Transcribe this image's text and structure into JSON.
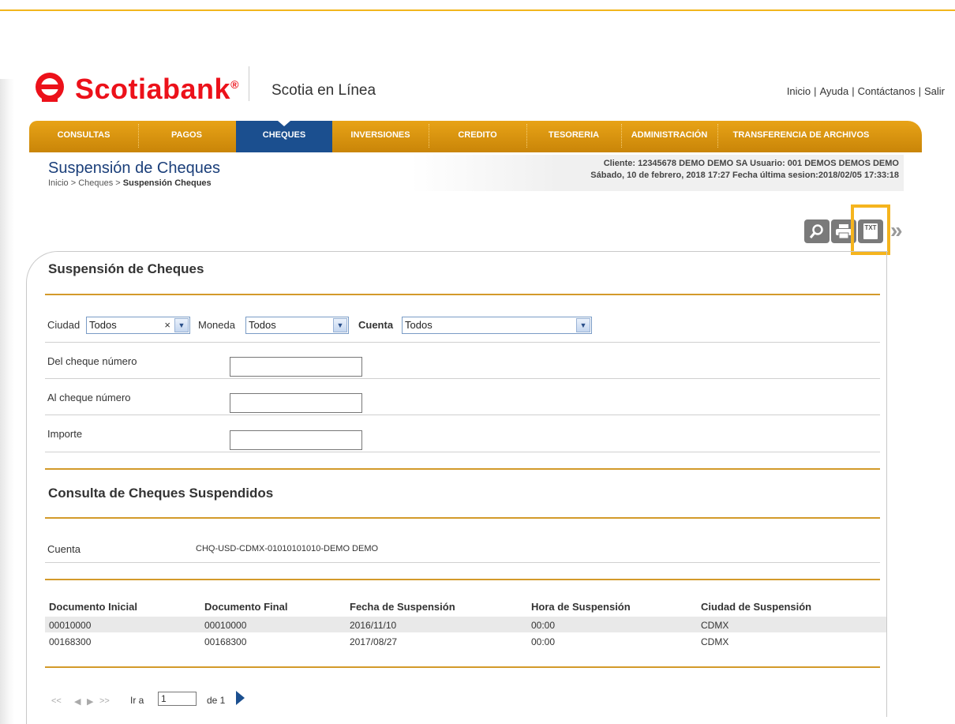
{
  "brand": {
    "name": "Scotiabank",
    "mark": "®",
    "app": "Scotia en Línea",
    "color": "#ec111a"
  },
  "top_links": [
    "Inicio",
    "Ayuda",
    "Contáctanos",
    "Salir"
  ],
  "nav": {
    "items": [
      "CONSULTAS",
      "PAGOS",
      "CHEQUES",
      "INVERSIONES",
      "CREDITO",
      "TESORERIA",
      "ADMINISTRACIÓN",
      "TRANSFERENCIA DE ARCHIVOS"
    ],
    "active": "CHEQUES"
  },
  "page": {
    "title": "Suspensión de Cheques",
    "breadcrumb_prefix": "Inicio > Cheques > ",
    "breadcrumb_current": "Suspensión Cheques"
  },
  "session": {
    "line1": "Cliente: 12345678 DEMO DEMO SA   Usuario: 001 DEMOS DEMOS DEMO",
    "line2": "Sábado, 10 de febrero, 2018 17:27   Fecha última sesion:2018/02/05 17:33:18"
  },
  "toolbar": {
    "search": "search-icon",
    "print": "print-icon",
    "export_txt": "TXT",
    "more": "»"
  },
  "form": {
    "section_title": "Suspensión de Cheques",
    "ciudad_label": "Ciudad",
    "ciudad_value": "Todos",
    "moneda_label": "Moneda",
    "moneda_value": "Todos",
    "cuenta_label": "Cuenta",
    "cuenta_value": "Todos",
    "del_label": "Del cheque número",
    "al_label": "Al cheque número",
    "importe_label": "Importe",
    "del_value": "",
    "al_value": "",
    "importe_value": ""
  },
  "results": {
    "section_title": "Consulta de Cheques Suspendidos",
    "cuenta_label": "Cuenta",
    "cuenta_value": "CHQ-USD-CDMX-01010101010-DEMO DEMO",
    "columns": [
      "Documento Inicial",
      "Documento Final",
      "Fecha de Suspensión",
      "Hora de Suspensión",
      "Ciudad de Suspensión"
    ],
    "rows": [
      [
        "00010000",
        "00010000",
        "2016/11/10",
        "00:00",
        "CDMX"
      ],
      [
        "00168300",
        "00168300",
        "2017/08/27",
        "00:00",
        "CDMX"
      ]
    ]
  },
  "pager": {
    "goto_label": "Ir a",
    "page": "1",
    "of_label": "de 1"
  },
  "colors": {
    "gold": "#e8a317",
    "navy": "#1b4f8f",
    "highlight": "#f5b41e"
  }
}
